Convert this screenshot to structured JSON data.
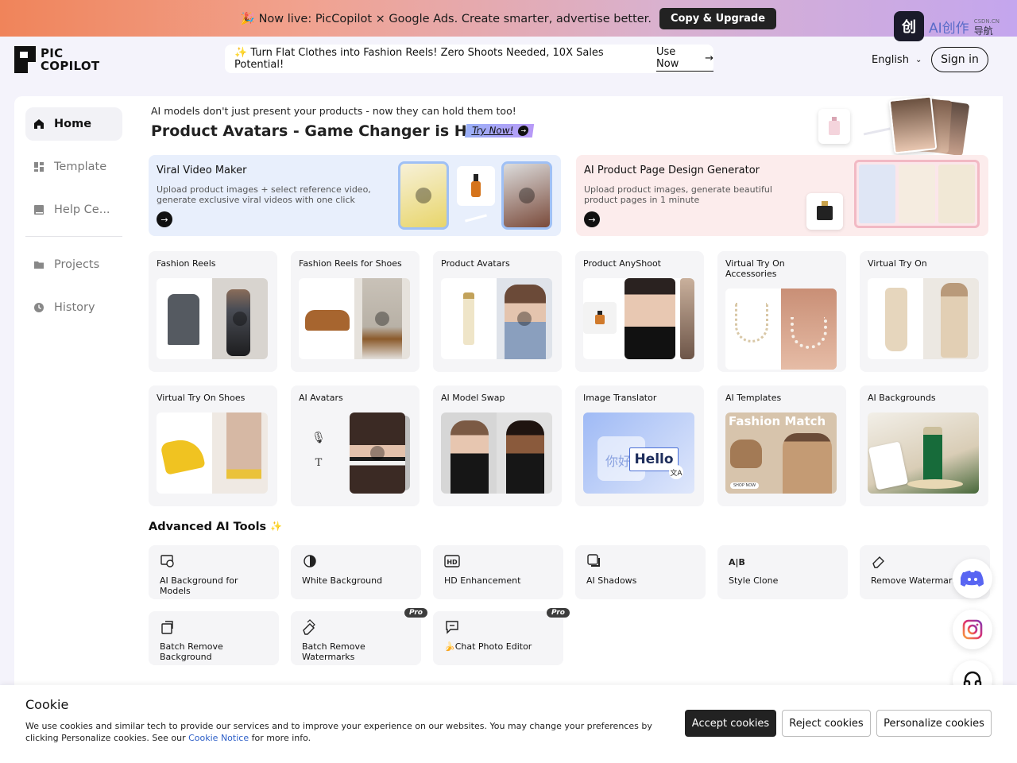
{
  "banner": {
    "text": "🎉 Now live: PicCopilot × Google Ads. Create smarter, advertise better.",
    "button": "Copy & Upgrade"
  },
  "watermark": {
    "logo": "创",
    "text": "AI创作",
    "sub1": "CSDN.CN",
    "sub2": "导航"
  },
  "header": {
    "logo_line1": "PIC",
    "logo_line2": "COPILOT",
    "promo_text": "✨ Turn Flat Clothes into Fashion Reels! Zero Shoots Needed, 10X Sales Potential!",
    "promo_link": "Use Now",
    "language": "English",
    "signin": "Sign in"
  },
  "sidebar": {
    "items": [
      {
        "label": "Home",
        "icon": "home-icon"
      },
      {
        "label": "Template",
        "icon": "template-icon"
      },
      {
        "label": "Help Ce...",
        "icon": "book-icon"
      },
      {
        "label": "Projects",
        "icon": "folder-icon"
      },
      {
        "label": "History",
        "icon": "clock-icon"
      }
    ]
  },
  "hero": {
    "subtitle": "AI models don't just present your products - now they can hold them too!",
    "title": "Product Avatars - Game Changer is Here!",
    "try_label": "Try Now!"
  },
  "feature_cards": [
    {
      "title": "Viral Video Maker",
      "desc": "Upload product images + select reference video, generate exclusive viral videos with one click"
    },
    {
      "title": "AI Product Page Design Generator",
      "desc": "Upload product images, generate beautiful product pages in 1 minute"
    }
  ],
  "tools": [
    {
      "title": "Fashion Reels"
    },
    {
      "title": "Fashion Reels for Shoes"
    },
    {
      "title": "Product Avatars"
    },
    {
      "title": "Product AnyShoot"
    },
    {
      "title": "Virtual Try On Accessories"
    },
    {
      "title": "Virtual Try On"
    },
    {
      "title": "Virtual Try On Shoes"
    },
    {
      "title": "AI Avatars"
    },
    {
      "title": "AI Model Swap"
    },
    {
      "title": "Image Translator",
      "img_text_1": "你好",
      "img_text_2": "Hello"
    },
    {
      "title": "AI Templates",
      "img_text_1": "Fashion Match",
      "img_text_2": "SHOP NOW"
    },
    {
      "title": "AI Backgrounds"
    }
  ],
  "advanced": {
    "title": "Advanced AI Tools",
    "items": [
      {
        "label": "AI Background for Models",
        "icon": "model-background-icon"
      },
      {
        "label": "White Background",
        "icon": "contrast-icon"
      },
      {
        "label": "HD Enhancement",
        "icon": "hd-icon"
      },
      {
        "label": "AI Shadows",
        "icon": "shadow-icon"
      },
      {
        "label": "Style Clone",
        "icon": "style-clone-icon",
        "icon_text": "A|B"
      },
      {
        "label": "Remove Watermark",
        "icon": "eraser-icon"
      },
      {
        "label": "Batch Remove Background",
        "icon": "batch-remove-icon"
      },
      {
        "label": "Batch Remove Watermarks",
        "icon": "batch-eraser-icon",
        "badge": "Pro"
      },
      {
        "label": "🍌Chat Photo Editor",
        "icon": "chat-icon",
        "badge": "Pro"
      }
    ]
  },
  "cookie": {
    "title": "Cookie",
    "body_pre": "We use cookies and similar tech to provide our services and to improve your experience on our websites. You may change your preferences by clicking Personalize cookies. See our ",
    "link": "Cookie Notice",
    "body_post": " for more info.",
    "accept": "Accept cookies",
    "reject": "Reject cookies",
    "personalize": "Personalize cookies"
  },
  "colors": {
    "accent_blue": "#e8effc",
    "accent_pink": "#fcecec",
    "dark": "#222222",
    "link": "#2c5ec7"
  }
}
